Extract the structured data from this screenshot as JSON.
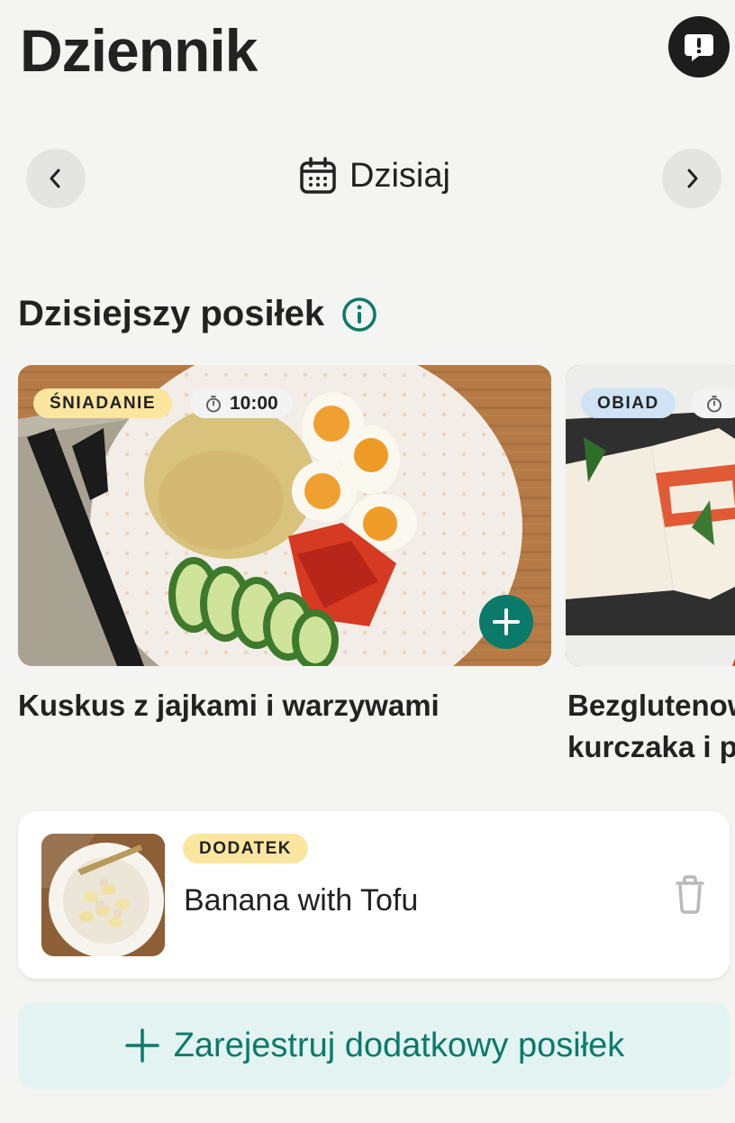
{
  "header": {
    "title": "Dziennik",
    "feedback_icon": "feedback-icon"
  },
  "date_nav": {
    "label": "Dzisiaj",
    "prev_icon": "chevron-left-icon",
    "next_icon": "chevron-right-icon",
    "calendar_icon": "calendar-icon"
  },
  "section": {
    "title": "Dzisiejszy posiłek",
    "info_icon": "info-icon"
  },
  "meals": [
    {
      "tag": "ŚNIADANIE",
      "time": "10:00",
      "name": "Kuskus z jajkami i warzywami",
      "image": "couscous-eggs-vegetables-photo"
    },
    {
      "tag": "OBIAD",
      "time": "",
      "name": "Bezglutenow",
      "name_line2": "kurczaka i p",
      "image": "quesadilla-photo"
    }
  ],
  "extra_meal": {
    "tag": "DODATEK",
    "name": "Banana with Tofu",
    "image": "banana-tofu-photo",
    "delete_icon": "trash-icon"
  },
  "register_button": {
    "label": "Zarejestruj dodatkowy posiłek",
    "icon": "plus-icon"
  },
  "colors": {
    "accent": "#0a7a6b",
    "tag_yellow": "#fbe6a0",
    "tag_blue": "#cfe3f4",
    "background": "#f4f4f2"
  }
}
